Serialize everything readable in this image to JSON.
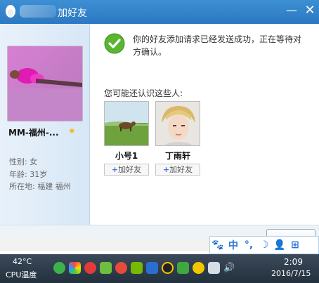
{
  "window": {
    "title": "加好友",
    "minimize_label": "—",
    "close_label": "✕"
  },
  "profile": {
    "nickname": "MM-福州-...",
    "star": "★",
    "gender": "性别: 女",
    "age": "年龄: 31岁",
    "location": "所在地: 福建  福州"
  },
  "status": {
    "message": "你的好友添加请求已经发送成功，正在等待对方确认。"
  },
  "suggestions": {
    "title": "您可能还认识这些人:",
    "items": [
      {
        "name": "小号1",
        "add_label": "加好友"
      },
      {
        "name": "丁雨轩",
        "add_label": "加好友"
      }
    ]
  },
  "ime": {
    "items": [
      "🐾",
      "中",
      "°,",
      "☽",
      "👤",
      "⊞"
    ]
  },
  "taskbar": {
    "temperature": "42°C",
    "cpu_label": "CPU温度",
    "time": "2:09",
    "date": "2016/7/15"
  },
  "colors": {
    "titlebar": "#2b78c2",
    "accent": "#3a7bd5",
    "check_green": "#5cb531"
  }
}
